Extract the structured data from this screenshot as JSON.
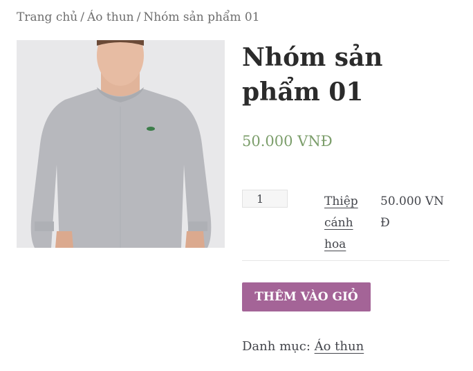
{
  "breadcrumb": {
    "home": "Trang chủ",
    "category": "Áo thun",
    "current": "Nhóm sản phẩm 01",
    "separator": "/"
  },
  "product": {
    "title": "Nhóm sản phẩm 01",
    "price": "50.000 VNĐ",
    "image_alt": "man-in-grey-sweatshirt"
  },
  "grouped": {
    "quantity": "1",
    "item_name": "Thiệp cánh hoa",
    "item_price": "50.000 VNĐ"
  },
  "add_to_cart_label": "THÊM VÀO GIỎ",
  "meta": {
    "category_label": "Danh mục:",
    "category_link": "Áo thun"
  },
  "colors": {
    "accent_button": "#a46497",
    "price": "#7c9e6b"
  }
}
